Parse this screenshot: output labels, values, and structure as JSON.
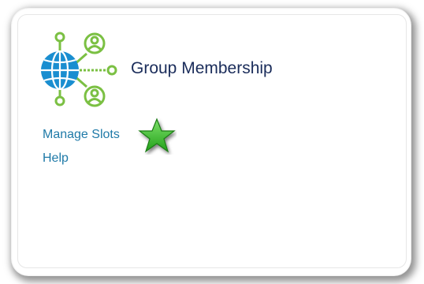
{
  "card": {
    "title": "Group Membership",
    "links": [
      {
        "label": "Manage Slots"
      },
      {
        "label": "Help"
      }
    ]
  },
  "icons": {
    "logo": "group-network-icon",
    "marker": "star-icon"
  },
  "colors": {
    "title": "#1a2c5a",
    "link": "#1f7aa8",
    "globe": "#1a8ed0",
    "node": "#7bc043",
    "star": "#3dba2e"
  }
}
